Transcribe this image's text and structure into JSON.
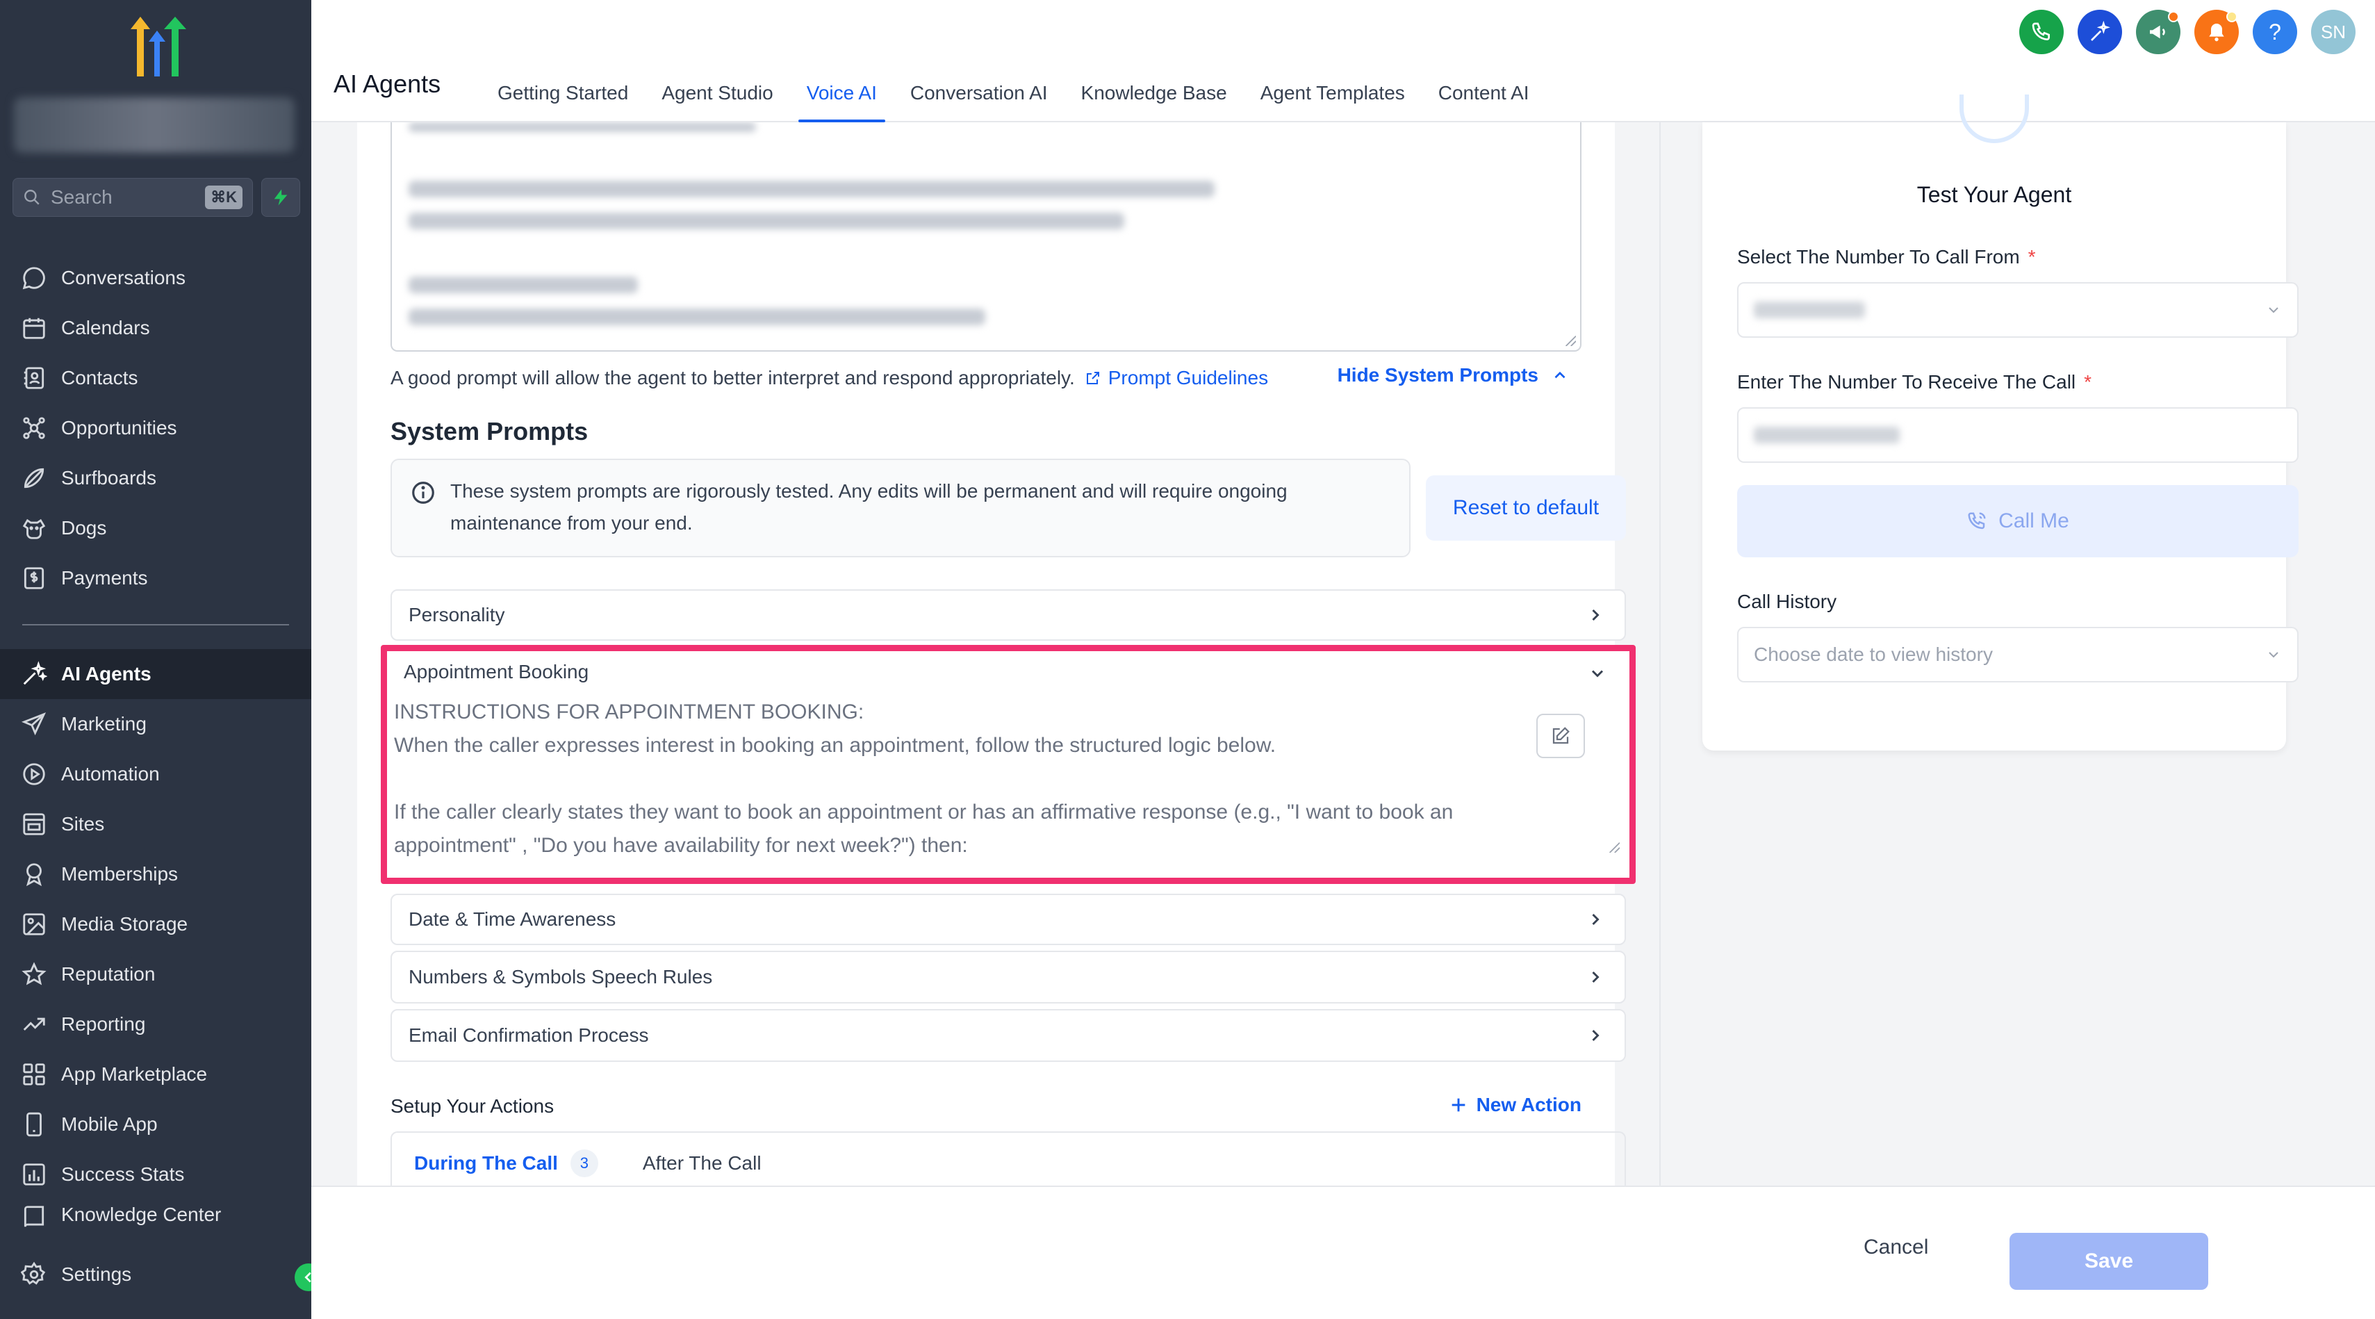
{
  "sidebar": {
    "search_label": "Search",
    "search_shortcut": "⌘K",
    "items": [
      {
        "label": "Conversations",
        "icon": "chat-icon"
      },
      {
        "label": "Calendars",
        "icon": "calendar-icon"
      },
      {
        "label": "Contacts",
        "icon": "contacts-icon"
      },
      {
        "label": "Opportunities",
        "icon": "opportunities-icon"
      },
      {
        "label": "Surfboards",
        "icon": "surfboard-icon"
      },
      {
        "label": "Dogs",
        "icon": "dog-icon"
      },
      {
        "label": "Payments",
        "icon": "payments-icon"
      },
      {
        "label": "AI Agents",
        "icon": "ai-sparkle-icon",
        "active": true
      },
      {
        "label": "Marketing",
        "icon": "send-icon"
      },
      {
        "label": "Automation",
        "icon": "automation-icon"
      },
      {
        "label": "Sites",
        "icon": "sites-icon"
      },
      {
        "label": "Memberships",
        "icon": "memberships-icon"
      },
      {
        "label": "Media Storage",
        "icon": "media-icon"
      },
      {
        "label": "Reputation",
        "icon": "star-icon"
      },
      {
        "label": "Reporting",
        "icon": "trending-icon"
      },
      {
        "label": "App Marketplace",
        "icon": "grid-icon"
      },
      {
        "label": "Mobile App",
        "icon": "mobile-icon"
      },
      {
        "label": "Success Stats",
        "icon": "bar-chart-icon"
      },
      {
        "label": "Knowledge Center",
        "icon": "book-icon"
      }
    ],
    "settings_label": "Settings"
  },
  "header": {
    "title": "AI Agents",
    "tabs": [
      {
        "label": "Getting Started"
      },
      {
        "label": "Agent Studio"
      },
      {
        "label": "Voice AI",
        "active": true
      },
      {
        "label": "Conversation AI"
      },
      {
        "label": "Knowledge Base"
      },
      {
        "label": "Agent Templates"
      },
      {
        "label": "Content AI"
      }
    ],
    "avatar_initials": "SN",
    "help_label": "?"
  },
  "main": {
    "helper_text": "A good prompt will allow the agent to better interpret and respond appropriately.",
    "prompt_guidelines": "Prompt Guidelines",
    "hide_system_prompts": "Hide System Prompts",
    "system_prompts_title": "System Prompts",
    "info_text": "These system prompts are rigorously tested. Any edits will be permanent and will require ongoing maintenance from your end.",
    "reset_label": "Reset to default",
    "personality_label": "Personality",
    "appointment": {
      "title": "Appointment Booking",
      "text": "INSTRUCTIONS FOR APPOINTMENT BOOKING:\nWhen the caller expresses interest in booking an appointment, follow the structured logic below.\n\nIf the caller clearly states they want to book an appointment or has an affirmative response (e.g., \"I want to book an appointment\" , \"Do you have availability for next week?\") then:"
    },
    "date_time_label": "Date & Time Awareness",
    "numbers_label": "Numbers & Symbols Speech Rules",
    "email_label": "Email Confirmation Process",
    "actions_title": "Setup Your Actions",
    "new_action_label": "New Action",
    "during_call_label": "During The Call",
    "during_call_count": "3",
    "after_call_label": "After The Call"
  },
  "test_panel": {
    "title": "Test Your Agent",
    "from_label": "Select The Number To Call From",
    "to_label": "Enter The Number To Receive The Call",
    "required_mark": "*",
    "call_me_label": "Call Me",
    "history_label": "Call History",
    "history_placeholder": "Choose date to view history"
  },
  "footer": {
    "cancel_label": "Cancel",
    "save_label": "Save"
  },
  "colors": {
    "sidebar_bg": "#2c3443",
    "accent": "#155eef",
    "highlight_border": "#f0306f"
  }
}
